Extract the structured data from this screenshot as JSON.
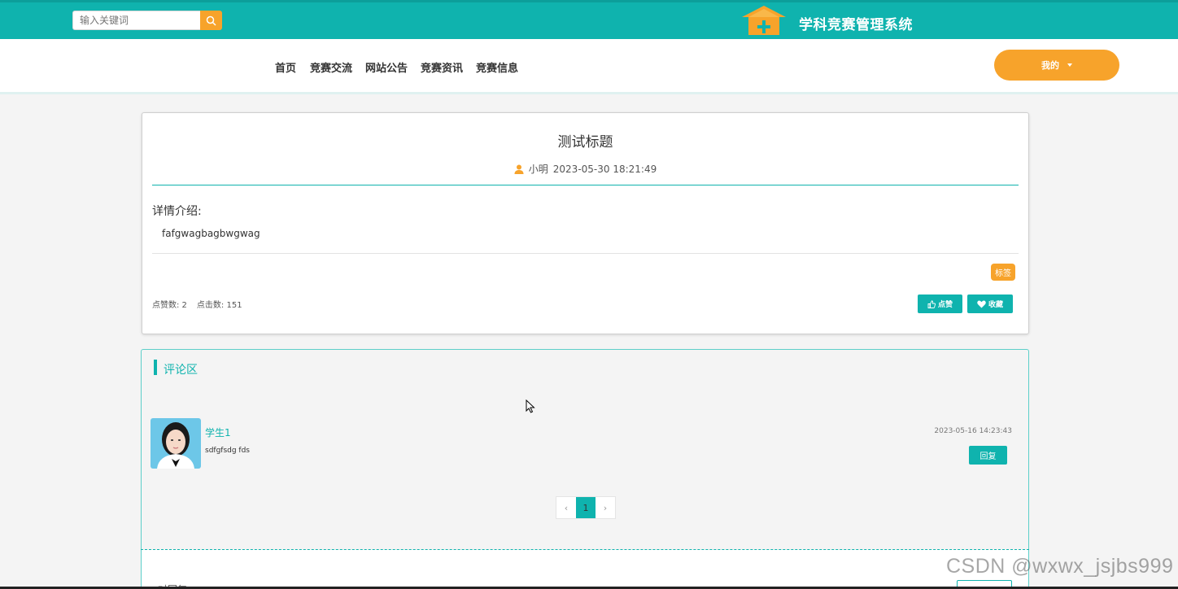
{
  "header": {
    "search_placeholder": "输入关键词",
    "search_icon": "search-icon",
    "site_title": "学科竞赛管理系统",
    "logo_icon": "house-plus-icon"
  },
  "nav": {
    "items": [
      {
        "label": "首页"
      },
      {
        "label": "竞赛交流"
      },
      {
        "label": "网站公告"
      },
      {
        "label": "竞赛资讯"
      },
      {
        "label": "竞赛信息"
      }
    ],
    "user_menu": "我的"
  },
  "post": {
    "title": "测试标题",
    "author": "小明",
    "datetime": "2023-05-30 18:21:49",
    "detail_label": "详情介绍:",
    "detail_content": "fafgwagbagbwgwag",
    "tag": "标签",
    "likes_text": "点赞数: 2",
    "clicks_text": "点击数: 151",
    "like_button": "点赞",
    "favorite_button": "收藏"
  },
  "comments": {
    "section_title": "评论区",
    "items": [
      {
        "user": "学生1",
        "content": "sdfgfsdg fds",
        "time": "2023-05-16 14:23:43",
        "reply_label": "回复"
      }
    ],
    "pager": {
      "prev": "‹",
      "current": "1",
      "next": "›"
    }
  },
  "lower": {
    "label": "对回复:"
  },
  "watermark": "CSDN @wxwx_jsjbs999",
  "colors": {
    "primary_teal": "#0fb3ae",
    "accent_orange": "#f7a32b"
  }
}
